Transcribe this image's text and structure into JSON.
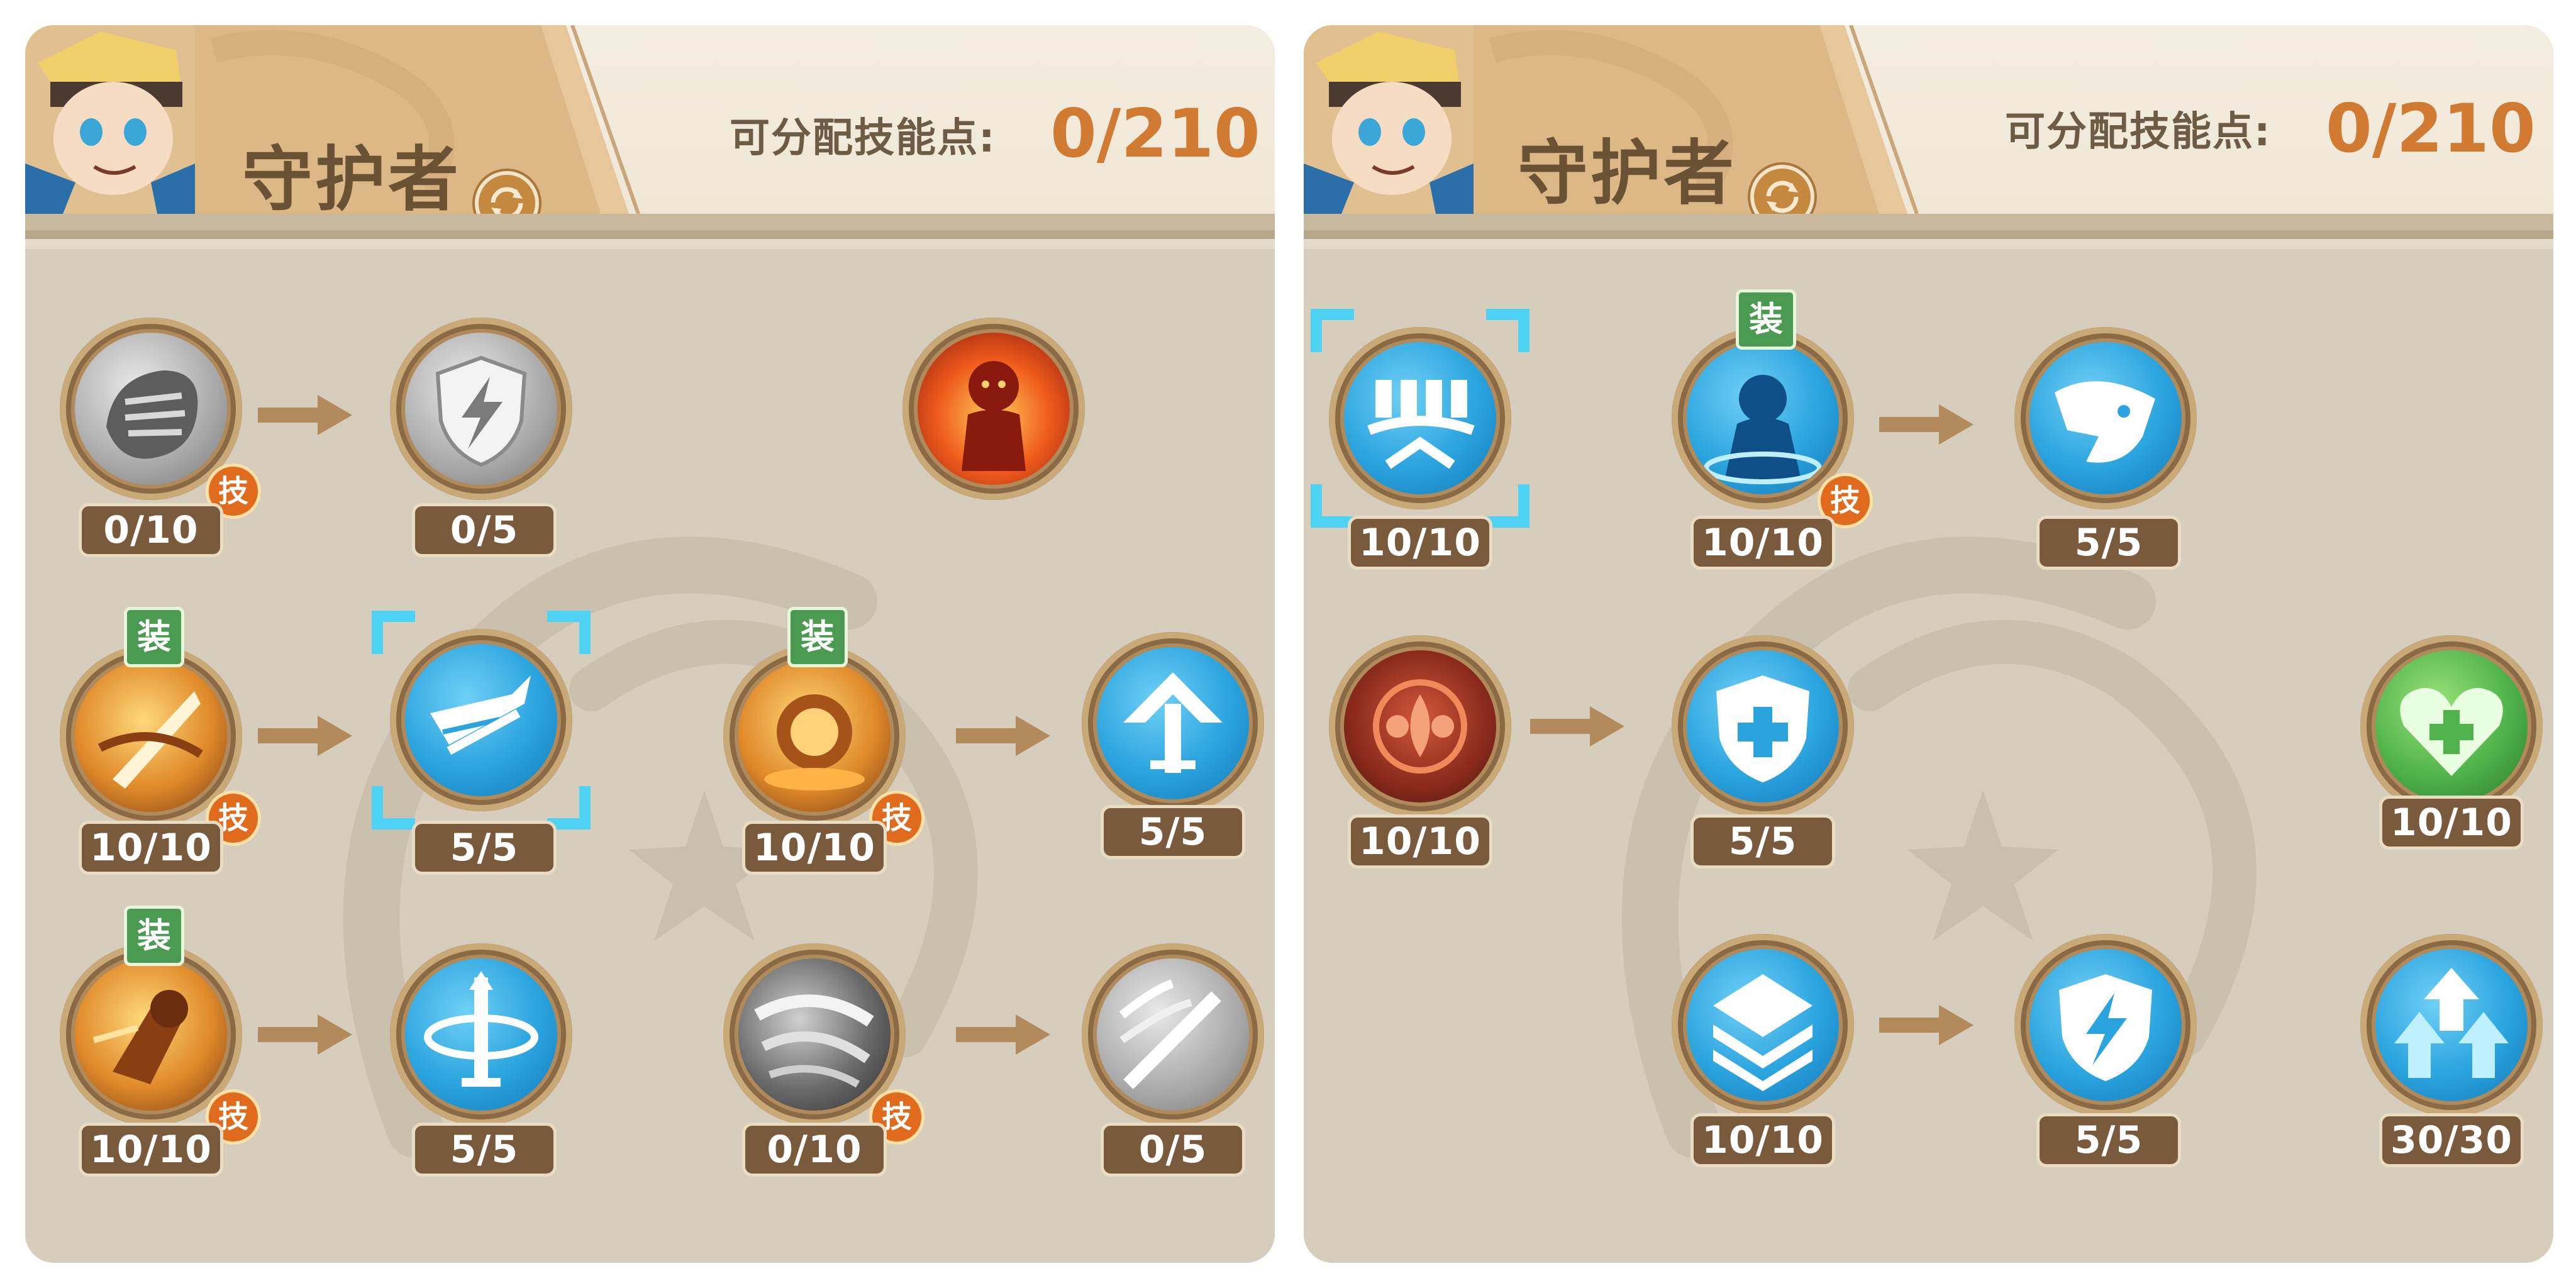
{
  "panels": [
    {
      "class_name": "守护者",
      "points_label": "可分配技能点:",
      "points_value": "0/210",
      "skills": [
        {
          "level": "0/10",
          "state": "locked",
          "icon": "fist-icon"
        },
        {
          "level": "0/5",
          "state": "locked",
          "icon": "lightning-shield-icon"
        },
        {
          "level": "",
          "state": "locked",
          "icon": "fire-warrior-icon"
        },
        {
          "level": "10/10",
          "state": "equipped",
          "icon": "slash-icon"
        },
        {
          "level": "5/5",
          "state": "selected",
          "icon": "winged-sword-icon"
        },
        {
          "level": "10/10",
          "state": "equipped",
          "icon": "golden-shield-icon"
        },
        {
          "level": "5/5",
          "state": "learned",
          "icon": "arrow-sword-icon"
        },
        {
          "level": "10/10",
          "state": "equipped",
          "icon": "charge-icon"
        },
        {
          "level": "5/5",
          "state": "learned",
          "icon": "spinning-sword-icon"
        },
        {
          "level": "0/10",
          "state": "locked",
          "icon": "whirlwind-icon"
        },
        {
          "level": "0/5",
          "state": "locked",
          "icon": "sword-slash-icon"
        }
      ]
    },
    {
      "class_name": "守护者",
      "points_label": "可分配技能点:",
      "points_value": "0/210",
      "skills": [
        {
          "level": "10/10",
          "state": "selected",
          "icon": "fortress-icon"
        },
        {
          "level": "10/10",
          "state": "equipped",
          "icon": "blue-aura-icon"
        },
        {
          "level": "5/5",
          "state": "learned",
          "icon": "eagle-icon"
        },
        {
          "level": "10/10",
          "state": "learned",
          "icon": "rune-emblem-icon"
        },
        {
          "level": "5/5",
          "state": "learned",
          "icon": "heal-shield-icon"
        },
        {
          "level": "10/10",
          "state": "learned",
          "icon": "heart-plus-icon"
        },
        {
          "level": "10/10",
          "state": "learned",
          "icon": "layers-icon"
        },
        {
          "level": "5/5",
          "state": "learned",
          "icon": "lightning-shield-icon"
        },
        {
          "level": "30/30",
          "state": "learned",
          "icon": "stat-up-icon"
        }
      ]
    }
  ],
  "badges": {
    "skill": "技",
    "equipped": "装"
  },
  "colors": {
    "accent": "#d17a31",
    "learned": "#2aa3de",
    "equipped_badge": "#4a9a52",
    "skill_badge": "#e06b1c"
  }
}
